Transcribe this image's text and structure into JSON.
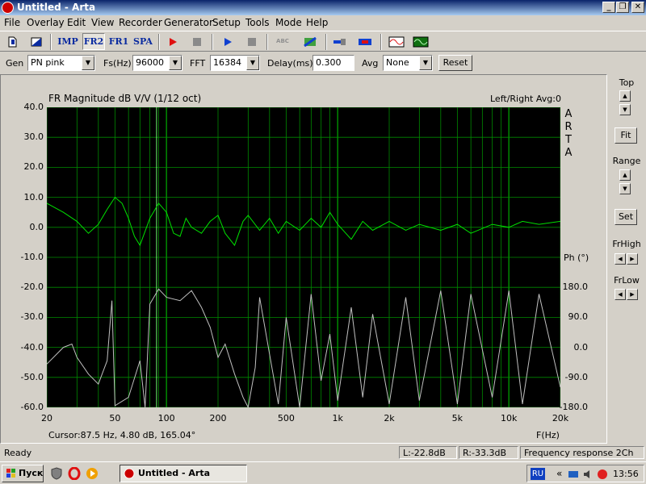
{
  "window": {
    "title": "Untitled - Arta",
    "minimize": "_",
    "restore": "❐",
    "close": "✕"
  },
  "menu": [
    "File",
    "Overlay",
    "Edit",
    "View",
    "Recorder",
    "Generator",
    "Setup",
    "Tools",
    "Mode",
    "Help"
  ],
  "toolbar": {
    "imp": "IMP",
    "fr2": "FR2",
    "fr1": "FR1",
    "spa": "SPA",
    "abc": "ABC"
  },
  "params": {
    "gen_label": "Gen",
    "gen_value": "PN pink",
    "fs_label": "Fs(Hz)",
    "fs_value": "96000",
    "fft_label": "FFT",
    "fft_value": "16384",
    "delay_label": "Delay(ms)",
    "delay_value": "0.300",
    "avg_label": "Avg",
    "avg_value": "None",
    "reset_label": "Reset"
  },
  "plot": {
    "title": "FR Magnitude dB V/V (1/12 oct)",
    "channel_info": "Left/Right Avg:0",
    "side_label": "ARTA",
    "phase_label": "Ph (°)",
    "cursor": "Cursor:87.5 Hz, 4.80 dB, 165.04°",
    "xlabel": "F(Hz)"
  },
  "chart_data": {
    "type": "line",
    "xscale": "log",
    "xlim": [
      20,
      20000
    ],
    "ylim": [
      -60,
      40
    ],
    "y2lim": [
      -180,
      180
    ],
    "grid": true,
    "yticks": [
      "40.0",
      "30.0",
      "20.0",
      "10.0",
      "0.0",
      "-10.0",
      "-20.0",
      "-30.0",
      "-40.0",
      "-50.0",
      "-60.0"
    ],
    "y2ticks": [
      "180.0",
      "90.0",
      "0.0",
      "-90.0",
      "-180.0"
    ],
    "xticks": [
      {
        "v": 20,
        "t": "20"
      },
      {
        "v": 50,
        "t": "50"
      },
      {
        "v": 100,
        "t": "100"
      },
      {
        "v": 200,
        "t": "200"
      },
      {
        "v": 500,
        "t": "500"
      },
      {
        "v": 1000,
        "t": "1k"
      },
      {
        "v": 2000,
        "t": "2k"
      },
      {
        "v": 5000,
        "t": "5k"
      },
      {
        "v": 10000,
        "t": "10k"
      },
      {
        "v": 20000,
        "t": "20k"
      }
    ],
    "cursor_hz": 87.5,
    "magnitude": [
      [
        20,
        8
      ],
      [
        25,
        5
      ],
      [
        30,
        2
      ],
      [
        35,
        -2
      ],
      [
        40,
        1
      ],
      [
        45,
        6
      ],
      [
        50,
        10
      ],
      [
        55,
        8
      ],
      [
        60,
        3
      ],
      [
        65,
        -3
      ],
      [
        70,
        -6
      ],
      [
        80,
        3
      ],
      [
        90,
        8
      ],
      [
        100,
        5
      ],
      [
        110,
        -2
      ],
      [
        120,
        -3
      ],
      [
        130,
        3
      ],
      [
        140,
        0
      ],
      [
        160,
        -2
      ],
      [
        180,
        2
      ],
      [
        200,
        4
      ],
      [
        220,
        -2
      ],
      [
        250,
        -6
      ],
      [
        280,
        2
      ],
      [
        300,
        4
      ],
      [
        350,
        -1
      ],
      [
        400,
        3
      ],
      [
        450,
        -2
      ],
      [
        500,
        2
      ],
      [
        600,
        -1
      ],
      [
        700,
        3
      ],
      [
        800,
        0
      ],
      [
        900,
        5
      ],
      [
        1000,
        1
      ],
      [
        1200,
        -4
      ],
      [
        1400,
        2
      ],
      [
        1600,
        -1
      ],
      [
        2000,
        2
      ],
      [
        2500,
        -1
      ],
      [
        3000,
        1
      ],
      [
        4000,
        -1
      ],
      [
        5000,
        1
      ],
      [
        6000,
        -2
      ],
      [
        8000,
        1
      ],
      [
        10000,
        0
      ],
      [
        12000,
        2
      ],
      [
        15000,
        1
      ],
      [
        20000,
        2
      ]
    ],
    "phase": [
      [
        20,
        -50
      ],
      [
        25,
        0
      ],
      [
        28,
        10
      ],
      [
        30,
        -30
      ],
      [
        35,
        -80
      ],
      [
        40,
        -110
      ],
      [
        45,
        -40
      ],
      [
        48,
        140
      ],
      [
        50,
        -175
      ],
      [
        60,
        -150
      ],
      [
        70,
        -40
      ],
      [
        75,
        -180
      ],
      [
        80,
        130
      ],
      [
        90,
        175
      ],
      [
        100,
        150
      ],
      [
        120,
        140
      ],
      [
        140,
        170
      ],
      [
        160,
        120
      ],
      [
        180,
        60
      ],
      [
        200,
        -30
      ],
      [
        220,
        10
      ],
      [
        250,
        -80
      ],
      [
        280,
        -150
      ],
      [
        300,
        -180
      ],
      [
        330,
        -60
      ],
      [
        350,
        150
      ],
      [
        400,
        -20
      ],
      [
        450,
        -170
      ],
      [
        500,
        90
      ],
      [
        600,
        -180
      ],
      [
        700,
        160
      ],
      [
        800,
        -100
      ],
      [
        900,
        40
      ],
      [
        1000,
        -160
      ],
      [
        1200,
        120
      ],
      [
        1400,
        -150
      ],
      [
        1600,
        100
      ],
      [
        2000,
        -170
      ],
      [
        2500,
        150
      ],
      [
        3000,
        -160
      ],
      [
        4000,
        170
      ],
      [
        5000,
        -170
      ],
      [
        6000,
        160
      ],
      [
        8000,
        -150
      ],
      [
        10000,
        170
      ],
      [
        12000,
        -170
      ],
      [
        15000,
        160
      ],
      [
        20000,
        -120
      ]
    ],
    "colors": {
      "magnitude": "#00e000",
      "phase": "#c0c0c0",
      "grid": "#008a00",
      "background": "#000000"
    }
  },
  "right_panel": {
    "top_label": "Top",
    "fit_label": "Fit",
    "range_label": "Range",
    "set_label": "Set",
    "frhigh_label": "FrHigh",
    "frlow_label": "FrLow"
  },
  "statusbar": {
    "ready": "Ready",
    "left_level": "L:-22.8dB",
    "right_level": "R:-33.3dB",
    "mode": "Frequency response 2Ch"
  },
  "taskbar": {
    "start": "Пуск",
    "task": "Untitled - Arta",
    "lang": "RU",
    "clock": "13:56"
  }
}
